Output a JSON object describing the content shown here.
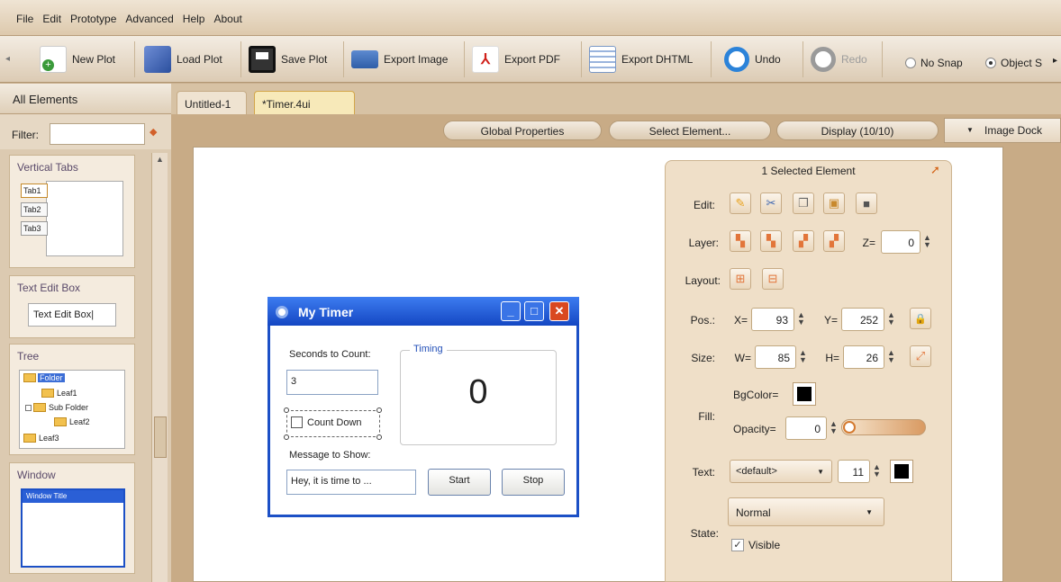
{
  "menu": [
    "File",
    "Edit",
    "Prototype",
    "Advanced",
    "Help",
    "About"
  ],
  "toolbar": {
    "buttons": [
      {
        "label": "New Plot",
        "icon": "new-plot-icon"
      },
      {
        "label": "Load Plot",
        "icon": "load-plot-icon"
      },
      {
        "label": "Save Plot",
        "icon": "save-plot-icon"
      },
      {
        "label": "Export Image",
        "icon": "export-image-icon"
      },
      {
        "label": "Export PDF",
        "icon": "export-pdf-icon"
      },
      {
        "label": "Export DHTML",
        "icon": "export-dhtml-icon"
      },
      {
        "label": "Undo",
        "icon": "undo-icon"
      },
      {
        "label": "Redo",
        "icon": "redo-icon"
      }
    ],
    "snap_options": [
      {
        "label": "No Snap",
        "selected": false
      },
      {
        "label": "Object S",
        "selected": true
      }
    ]
  },
  "left_panel": {
    "header": "All Elements",
    "filter_label": "Filter:",
    "filter_value": "",
    "elements": [
      {
        "title": "Vertical Tabs",
        "tabs": [
          "Tab1",
          "Tab2",
          "Tab3"
        ]
      },
      {
        "title": "Text Edit Box",
        "sample": "Text Edit Box"
      },
      {
        "title": "Tree",
        "nodes": [
          "Folder",
          "Leaf1",
          "Sub Folder",
          "Leaf2",
          "Leaf3"
        ]
      },
      {
        "title": "Window",
        "window_title": "Window Title"
      }
    ]
  },
  "tabs": [
    {
      "label": "Untitled-1",
      "active": false
    },
    {
      "label": "*Timer.4ui",
      "active": true
    }
  ],
  "canvas_toolbar": {
    "global_properties": "Global Properties",
    "select_element": "Select Element...",
    "display": "Display (10/10)",
    "image_dock": "Image Dock"
  },
  "timer_window": {
    "title": "My Timer",
    "seconds_label": "Seconds to Count:",
    "seconds_value": "3",
    "count_down_label": "Count Down",
    "count_down_checked": false,
    "message_label": "Message to Show:",
    "message_value": "Hey, it is time to ...",
    "timing_label": "Timing",
    "timing_value": "0",
    "start_label": "Start",
    "stop_label": "Stop"
  },
  "properties": {
    "header": "1 Selected Element",
    "edit_label": "Edit:",
    "layer_label": "Layer:",
    "z_label": "Z=",
    "z_value": "0",
    "layout_label": "Layout:",
    "pos_label": "Pos.:",
    "x_label": "X=",
    "x_value": "93",
    "y_label": "Y=",
    "y_value": "252",
    "size_label": "Size:",
    "w_label": "W=",
    "w_value": "85",
    "h_label": "H=",
    "h_value": "26",
    "fill_label": "Fill:",
    "bgcolor_label": "BgColor=",
    "bgcolor": "#000000",
    "opacity_label": "Opacity=",
    "opacity_value": "0",
    "text_label": "Text:",
    "font_value": "<default>",
    "font_size": "11",
    "text_color": "#000000",
    "state_label": "State:",
    "state_value": "Normal",
    "visible_label": "Visible",
    "visible_checked": true
  }
}
